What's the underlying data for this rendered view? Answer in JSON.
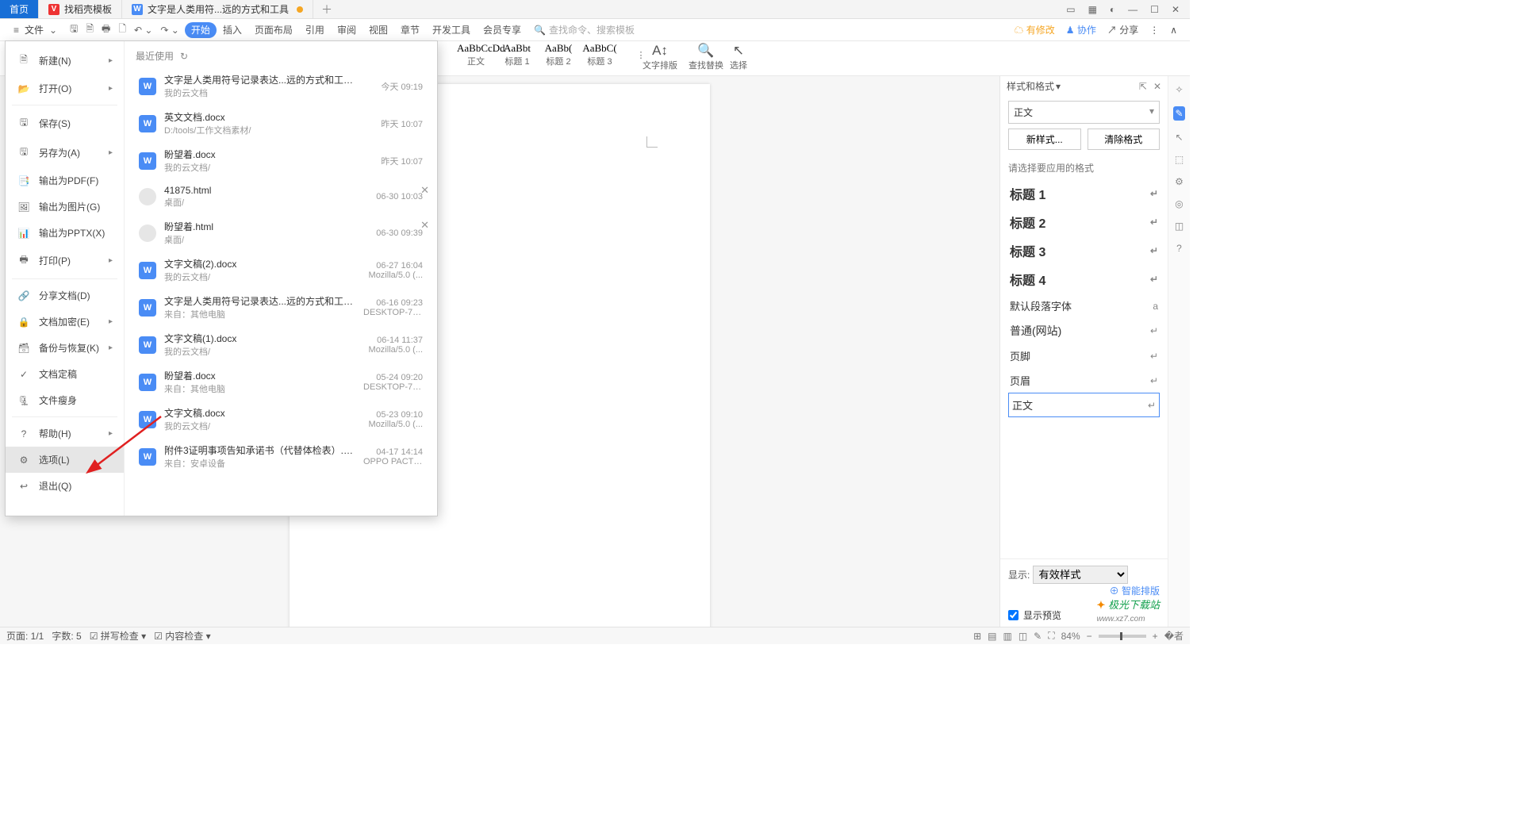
{
  "tabs": {
    "home": "首页",
    "tpl": "找稻壳模板",
    "doc": "文字是人类用符...远的方式和工具"
  },
  "menubar": {
    "file": "文件",
    "items": [
      "开始",
      "插入",
      "页面布局",
      "引用",
      "审阅",
      "视图",
      "章节",
      "开发工具",
      "会员专享"
    ],
    "search": "查找命令、搜索模板",
    "right": {
      "changes": "有修改",
      "coop": "协作",
      "share": "分享"
    }
  },
  "styles": {
    "items": [
      {
        "p": "AaBbCcDd",
        "l": "正文"
      },
      {
        "p": "AaBbt",
        "l": "标题 1"
      },
      {
        "p": "AaBb(",
        "l": "标题 2"
      },
      {
        "p": "AaBbC(",
        "l": "标题 3"
      }
    ],
    "g1": "文字排版",
    "g2": "查找替换",
    "g3": "选择"
  },
  "fileMenu": {
    "left": [
      {
        "id": "new",
        "t": "新建(N)",
        "a": true
      },
      {
        "id": "open",
        "t": "打开(O)",
        "a": true
      },
      {
        "id": "sep"
      },
      {
        "id": "save",
        "t": "保存(S)"
      },
      {
        "id": "saveas",
        "t": "另存为(A)",
        "a": true
      },
      {
        "id": "pdf",
        "t": "输出为PDF(F)"
      },
      {
        "id": "img",
        "t": "输出为图片(G)"
      },
      {
        "id": "pptx",
        "t": "输出为PPTX(X)"
      },
      {
        "id": "print",
        "t": "打印(P)",
        "a": true
      },
      {
        "id": "sep"
      },
      {
        "id": "share",
        "t": "分享文档(D)"
      },
      {
        "id": "encrypt",
        "t": "文档加密(E)",
        "a": true
      },
      {
        "id": "backup",
        "t": "备份与恢复(K)",
        "a": true
      },
      {
        "id": "finalize",
        "t": "文档定稿"
      },
      {
        "id": "slim",
        "t": "文件瘦身"
      },
      {
        "id": "sep"
      },
      {
        "id": "help",
        "t": "帮助(H)",
        "a": true
      },
      {
        "id": "options",
        "t": "选项(L)",
        "hl": true
      },
      {
        "id": "exit",
        "t": "退出(Q)"
      }
    ],
    "recentHdr": "最近使用",
    "recent": [
      {
        "ic": "W",
        "n": "文字是人类用符号记录表达...远的方式和工具.docx",
        "l": "我的云文档",
        "t": "今天  09:19",
        "s": ""
      },
      {
        "ic": "W",
        "n": "英文文档.docx",
        "l": "D:/tools/工作文档素材/",
        "t": "昨天  10:07",
        "s": ""
      },
      {
        "ic": "W",
        "n": "盼望着.docx",
        "l": "我的云文档/",
        "t": "昨天  10:07",
        "s": ""
      },
      {
        "ic": "H",
        "n": "41875.html",
        "l": "桌面/",
        "t": "06-30 10:03",
        "s": "",
        "x": true
      },
      {
        "ic": "H",
        "n": "盼望着.html",
        "l": "桌面/",
        "t": "06-30 09:39",
        "s": "",
        "x": true
      },
      {
        "ic": "W",
        "n": "文字文稿(2).docx",
        "l": "我的云文档/",
        "t": "06-27 16:04",
        "s": "Mozilla/5.0 (..."
      },
      {
        "ic": "W",
        "n": "文字是人类用符号记录表达...远的方式和工具.docx",
        "l": "来自：其他电脑",
        "t": "06-16 09:23",
        "s": "DESKTOP-7S..."
      },
      {
        "ic": "W",
        "n": "文字文稿(1).docx",
        "l": "我的云文档/",
        "t": "06-14 11:37",
        "s": "Mozilla/5.0 (..."
      },
      {
        "ic": "W",
        "n": "盼望着.docx",
        "l": "来自：其他电脑",
        "t": "05-24 09:20",
        "s": "DESKTOP-7S..."
      },
      {
        "ic": "W",
        "n": "文字文稿.docx",
        "l": "我的云文档/",
        "t": "05-23 09:10",
        "s": "Mozilla/5.0 (..."
      },
      {
        "ic": "W",
        "n": "附件3证明事项告知承诺书（代替体检表）.doc",
        "l": "来自：安卓设备",
        "t": "04-17 14:14",
        "s": "OPPO PACT00"
      }
    ]
  },
  "sidePanel": {
    "title": "样式和格式",
    "current": "正文",
    "btnNew": "新样式...",
    "btnClear": "清除格式",
    "hint": "请选择要应用的格式",
    "list": [
      {
        "t": "标题 1",
        "b": true
      },
      {
        "t": "标题 2",
        "b": true
      },
      {
        "t": "标题 3",
        "b": true
      },
      {
        "t": "标题 4",
        "b": true
      },
      {
        "t": "默认段落字体",
        "m": "a"
      },
      {
        "t": "普通(网站)",
        "sz": 14
      },
      {
        "t": "页脚"
      },
      {
        "t": "页眉"
      },
      {
        "t": "正文",
        "sel": true
      }
    ],
    "show": "显示:",
    "showVal": "有效样式",
    "smart": "智能排版",
    "preview": "显示预览"
  },
  "status": {
    "page": "页面: 1/1",
    "words": "字数: 5",
    "spell": "拼写检查",
    "content": "内容检查",
    "zoom": "84%"
  },
  "watermark": "极光下载站"
}
